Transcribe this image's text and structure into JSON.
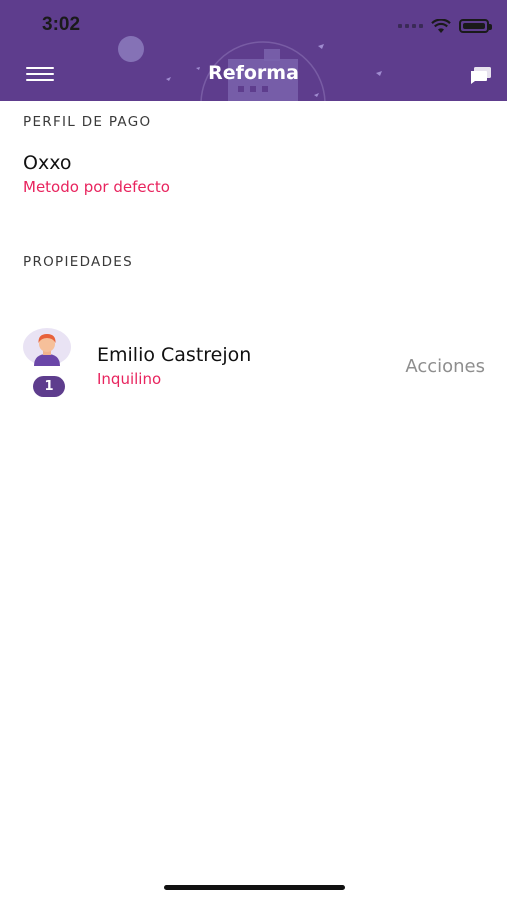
{
  "status_bar": {
    "time": "3:02"
  },
  "header": {
    "title": "Reforma",
    "menu_icon": "hamburger-menu-icon",
    "chat_icon": "chat-icon",
    "background_color": "#5e3d8d"
  },
  "payment_profile": {
    "section_title": "PERFIL DE PAGO",
    "method_name": "Oxxo",
    "method_status": "Metodo por defecto"
  },
  "properties": {
    "section_title": "PROPIEDADES",
    "items": [
      {
        "name": "Emilio Castrejon",
        "role": "Inquilino",
        "badge_count": "1",
        "action_label": "Acciones",
        "avatar_icon": "user-avatar-icon"
      }
    ]
  },
  "colors": {
    "accent": "#e8245e",
    "primary": "#5e3d8d",
    "muted": "#8e8e8e"
  }
}
